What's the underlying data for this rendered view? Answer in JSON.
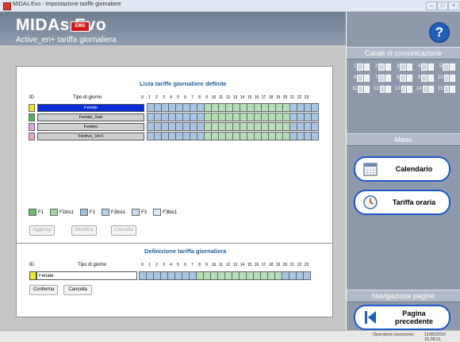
{
  "window": {
    "title": "MIDAs Evo - Impostazione tariffe giornaliere",
    "buttons": [
      "–",
      "□",
      "×"
    ]
  },
  "header": {
    "app_name": "MIDAs Evo",
    "badge": "EMS",
    "subtitle": "Active_en+ tariffa giornaliera"
  },
  "list_section": {
    "title": "Lista tariffe giornaliere definite",
    "col_id": "ID",
    "col_day": "Tipo di giorno",
    "hours": [
      "0",
      "1",
      "2",
      "3",
      "4",
      "5",
      "6",
      "7",
      "8",
      "9",
      "10",
      "11",
      "12",
      "13",
      "14",
      "15",
      "16",
      "17",
      "18",
      "19",
      "20",
      "21",
      "22",
      "23"
    ],
    "rows": [
      {
        "name": "Feriale",
        "swatch": "#e8e82c",
        "selected": true
      },
      {
        "name": "Feriale_Sab",
        "swatch": "#4fb060",
        "selected": false
      },
      {
        "name": "Festivo",
        "swatch": "#d9a6e0",
        "selected": false
      },
      {
        "name": "Festivo_Ver1",
        "swatch": "#e6a2cf",
        "selected": false
      }
    ],
    "hour_fill": [
      "b",
      "b",
      "b",
      "b",
      "b",
      "b",
      "b",
      "b",
      "g",
      "g",
      "g",
      "g",
      "g",
      "g",
      "g",
      "g",
      "g",
      "g",
      "g",
      "g",
      "b",
      "b",
      "b",
      "b"
    ]
  },
  "legend": [
    {
      "label": "F1",
      "color": "#6dbb6d"
    },
    {
      "label": "F1bis1",
      "color": "#9fd79f"
    },
    {
      "label": "F2",
      "color": "#9fc0e0"
    },
    {
      "label": "F2bis1",
      "color": "#b6d2ea"
    },
    {
      "label": "F3",
      "color": "#c8dcef"
    },
    {
      "label": "F3bis1",
      "color": "#dbe8f5"
    }
  ],
  "list_buttons": {
    "add": "Aggiungi",
    "edit": "Modifica",
    "delete": "Cancella"
  },
  "definition_section": {
    "title": "Definizione tariffa giornaliera",
    "col_id": "ID",
    "col_day": "Tipo di giorno",
    "name_value": "Feriale",
    "swatch": "#e8e82c"
  },
  "def_buttons": {
    "confirm": "Conferma",
    "cancel": "Cancella"
  },
  "sidebar": {
    "channels_title": "Canali di comunicazione",
    "channels": [
      "1",
      "2",
      "3",
      "4",
      "5",
      "6",
      "7",
      "8",
      "9",
      "10",
      "11",
      "12",
      "13",
      "14",
      "15"
    ],
    "menu_title": "Menu",
    "calendar_label": "Calendario",
    "tariff_label": "Tariffa oraria",
    "nav_title": "Navigazione pagine",
    "prev_label": "Pagina precedente"
  },
  "status": {
    "user": "Operatore (sessione)",
    "date": "11/05/2016 15:38:11"
  },
  "colors": {
    "green_cell": "#b5ddb5",
    "blue_cell": "#a8c6e3",
    "selected_row": "#0a2bd8"
  }
}
